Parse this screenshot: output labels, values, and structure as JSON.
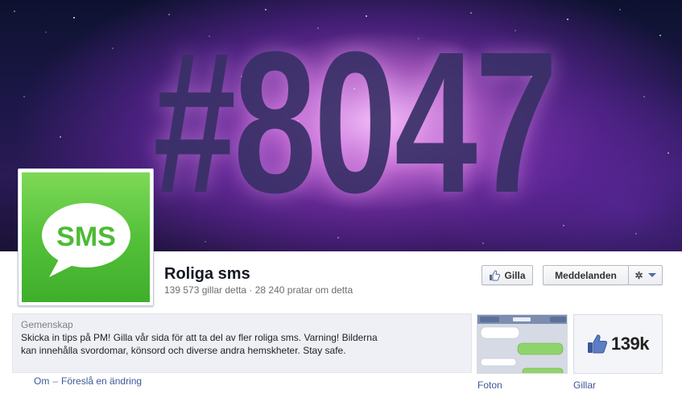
{
  "cover": {
    "text": "#8047"
  },
  "profile": {
    "logo_text": "SMS"
  },
  "page": {
    "name": "Roliga sms",
    "stats": "139 573 gillar detta · 28 240 pratar om detta"
  },
  "actions": {
    "like_label": "Gilla",
    "message_label": "Meddelanden",
    "gear_icon": "gear-icon"
  },
  "about": {
    "category": "Gemenskap",
    "description": "Skicka in tips på PM! Gilla vår sida för att ta del av fler roliga sms. Varning! Bilderna kan innehålla svordomar, könsord och diverse andra hemskheter. Stay safe.",
    "link_about": "Om",
    "link_suggest": "Föreslå en ändring"
  },
  "apps": {
    "photos_label": "Foton",
    "likes_label": "Gillar",
    "likes_count": "139k"
  },
  "colors": {
    "link": "#3b5998",
    "sms_green": "#4cbb35"
  }
}
